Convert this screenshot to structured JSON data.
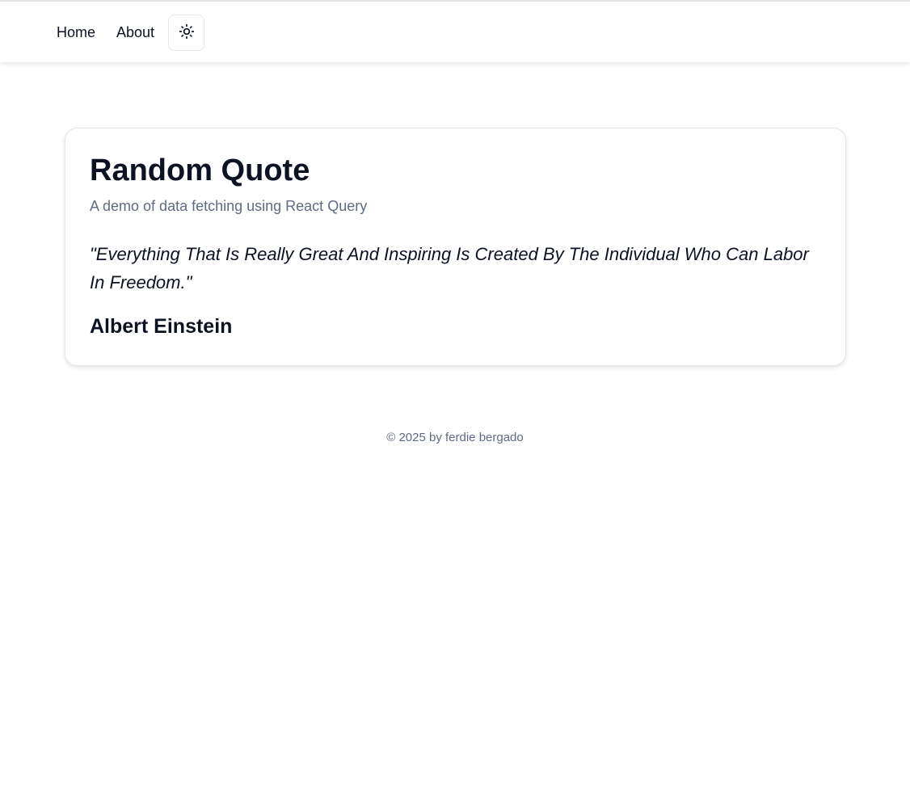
{
  "nav": {
    "home_label": "Home",
    "about_label": "About",
    "theme_toggle_icon": "sun-icon"
  },
  "card": {
    "title": "Random Quote",
    "subtitle": "A demo of data fetching using React Query",
    "quote": "\"Everything That Is Really Great And Inspiring Is Created By The Individual Who Can Labor In Freedom.\"",
    "author": "Albert Einstein"
  },
  "footer": {
    "text": "© 2025 by ferdie bergado"
  },
  "colors": {
    "text_primary": "#0b1222",
    "text_muted": "#5f6b80",
    "border": "#e5e7eb",
    "background": "#ffffff"
  }
}
